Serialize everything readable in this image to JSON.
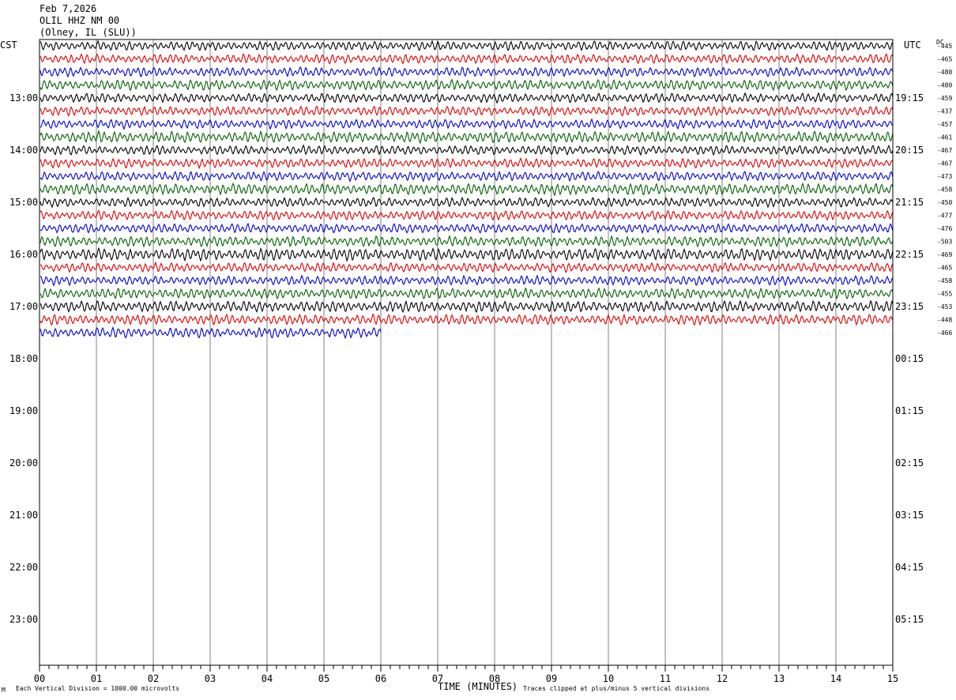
{
  "header": {
    "date": "Feb 7,2026",
    "station": "OLIL HHZ NM 00",
    "location": "(Olney, IL (SLU))"
  },
  "left_axis_title": "CST",
  "right_axis_title": "UTC",
  "dc_title": "DC",
  "footer": {
    "left_note": "Each Vertical Division = 1000.00 microvolts",
    "center_label": "TIME (MINUTES)",
    "right_note": "Traces clipped at plus/minus 5 vertical divisions",
    "corner_mark": "M"
  },
  "colors": {
    "trace_cycle": [
      "#000000",
      "#e00000",
      "#0000d0",
      "#006000"
    ],
    "grid": "#808080",
    "frame": "#000000"
  },
  "chart_data": {
    "type": "line",
    "description_units": "helicorder: rows of 15 minutes, x in minutes, hour labels every 4 rows",
    "x_range": [
      0,
      15
    ],
    "x_ticks": [
      "00",
      "01",
      "02",
      "03",
      "04",
      "05",
      "06",
      "07",
      "08",
      "09",
      "10",
      "11",
      "12",
      "13",
      "14",
      "15"
    ],
    "cst_hour_labels": [
      "13:00",
      "14:00",
      "15:00",
      "16:00",
      "17:00",
      "18:00",
      "19:00",
      "20:00",
      "21:00",
      "22:00",
      "23:00"
    ],
    "utc_hour_labels": [
      "19:15",
      "20:15",
      "21:15",
      "22:15",
      "23:15",
      "00:15",
      "01:15",
      "02:15",
      "03:15",
      "04:15",
      "05:15"
    ],
    "traces": [
      {
        "dc": "-445",
        "end_minute": 15,
        "amplitude": 1.0
      },
      {
        "dc": "-465",
        "end_minute": 15,
        "amplitude": 1.0
      },
      {
        "dc": "-480",
        "end_minute": 15,
        "amplitude": 1.0
      },
      {
        "dc": "-480",
        "end_minute": 15,
        "amplitude": 1.1
      },
      {
        "dc": "-459",
        "end_minute": 15,
        "amplitude": 1.0
      },
      {
        "dc": "-437",
        "end_minute": 15,
        "amplitude": 1.0
      },
      {
        "dc": "-457",
        "end_minute": 15,
        "amplitude": 1.0
      },
      {
        "dc": "-461",
        "end_minute": 15,
        "amplitude": 1.2
      },
      {
        "dc": "-467",
        "end_minute": 15,
        "amplitude": 1.0
      },
      {
        "dc": "-467",
        "end_minute": 15,
        "amplitude": 1.0
      },
      {
        "dc": "-473",
        "end_minute": 15,
        "amplitude": 1.0
      },
      {
        "dc": "-458",
        "end_minute": 15,
        "amplitude": 1.2
      },
      {
        "dc": "-450",
        "end_minute": 15,
        "amplitude": 1.0
      },
      {
        "dc": "-477",
        "end_minute": 15,
        "amplitude": 1.0
      },
      {
        "dc": "-476",
        "end_minute": 15,
        "amplitude": 1.0
      },
      {
        "dc": "-503",
        "end_minute": 15,
        "amplitude": 1.1
      },
      {
        "dc": "-469",
        "end_minute": 15,
        "amplitude": 1.3
      },
      {
        "dc": "-465",
        "end_minute": 15,
        "amplitude": 1.0
      },
      {
        "dc": "-458",
        "end_minute": 15,
        "amplitude": 1.0
      },
      {
        "dc": "-455",
        "end_minute": 15,
        "amplitude": 1.1
      },
      {
        "dc": "-453",
        "end_minute": 15,
        "amplitude": 1.2
      },
      {
        "dc": "-448",
        "end_minute": 15,
        "amplitude": 1.1
      },
      {
        "dc": "-466",
        "end_minute": 6,
        "amplitude": 1.1
      }
    ]
  }
}
